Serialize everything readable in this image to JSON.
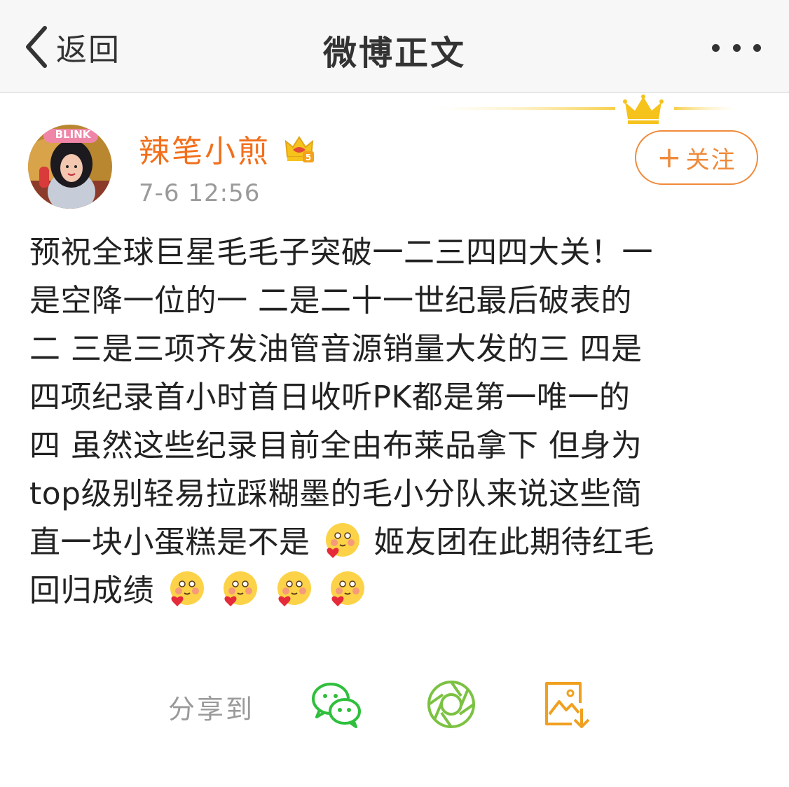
{
  "nav": {
    "back_label": "返回",
    "title": "微博正文"
  },
  "post": {
    "username": "辣笔小煎",
    "timestamp": "7-6 12:56",
    "follow_label": "关注",
    "avatar_text": "BLINK",
    "badge_level": "5",
    "lines": [
      "预祝全球巨星毛毛子突破一二三四四大关！一",
      "是空降一位的一 二是二十一世纪最后破表的",
      "二 三是三项齐发油管音源销量大发的三 四是",
      "四项纪录首小时首日收听PK都是第一唯一的",
      "四 虽然这些纪录目前全由布莱品拿下 但身为",
      "top级别轻易拉踩糊墨的毛小分队来说这些简",
      "直一块小蛋糕是不是",
      "姬友团在此期待红毛",
      "回归成绩"
    ]
  },
  "share": {
    "label": "分享到",
    "icons": [
      "wechat-icon",
      "moments-icon",
      "save-image-icon"
    ]
  },
  "colors": {
    "username": "#f26f1b",
    "follow": "#f08a3a",
    "wechat": "#2fbf3c",
    "moments": "#7cc242",
    "save": "#f0a020"
  }
}
